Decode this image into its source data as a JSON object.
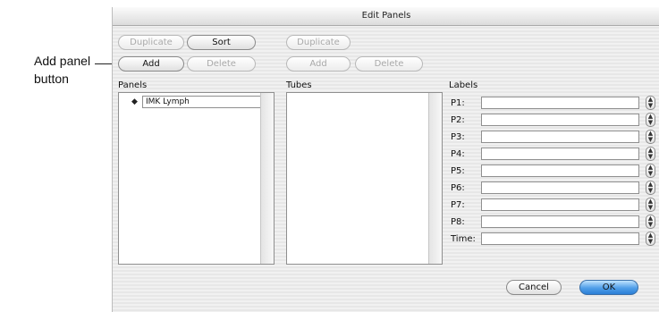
{
  "callout": {
    "text": "Add panel button"
  },
  "window": {
    "title": "Edit Panels"
  },
  "panels_toolbar": {
    "duplicate": "Duplicate",
    "sort": "Sort",
    "add": "Add",
    "delete": "Delete"
  },
  "tubes_toolbar": {
    "duplicate": "Duplicate",
    "add": "Add",
    "delete": "Delete"
  },
  "panels": {
    "header": "Panels",
    "items": [
      "IMK Lymph"
    ]
  },
  "tubes": {
    "header": "Tubes"
  },
  "labels": {
    "header": "Labels",
    "rows": [
      "P1:",
      "P2:",
      "P3:",
      "P4:",
      "P5:",
      "P6:",
      "P7:",
      "P8:",
      "Time:"
    ]
  },
  "footer": {
    "cancel": "Cancel",
    "ok": "OK"
  },
  "colors": {
    "default_button": "#4f9ee8",
    "window_bg": "#eeeeee"
  }
}
